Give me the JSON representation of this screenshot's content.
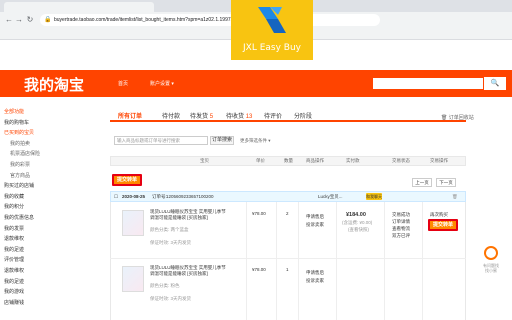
{
  "browser": {
    "url": "buyertrade.taobao.com/trade/itemlist/list_bought_items.htm?spm=a1z02.1.1997525045.2.wLuLBM"
  },
  "overlay": {
    "app_name": "JXL Easy Buy",
    "accent": "#f8c411"
  },
  "taobao": {
    "brand": "我的淘宝",
    "nav": [
      "首页",
      "账户设置 ▾"
    ],
    "search_button": "🔍",
    "brand_color": "#ff4400"
  },
  "sidebar": {
    "items": [
      {
        "label": "全部功能",
        "style": "red"
      },
      {
        "label": "我的购物车",
        "style": "normal"
      },
      {
        "label": "已买到的宝贝",
        "style": "red"
      },
      {
        "label": "我的拍卖",
        "style": "sub"
      },
      {
        "label": "机票酒店保险",
        "style": "sub"
      },
      {
        "label": "我的彩票",
        "style": "sub"
      },
      {
        "label": "官方商品",
        "style": "sub"
      },
      {
        "label": "购买过的店铺",
        "style": "normal"
      },
      {
        "label": "我的收藏",
        "style": "normal"
      },
      {
        "label": "我的积分",
        "style": "normal"
      },
      {
        "label": "我的优惠信息",
        "style": "normal"
      },
      {
        "label": "我的发票",
        "style": "normal"
      },
      {
        "label": "退款维权",
        "style": "normal"
      },
      {
        "label": "我的足迹",
        "style": "normal"
      },
      {
        "label": "评价管理",
        "style": "normal"
      },
      {
        "label": "退款维权",
        "style": "normal"
      },
      {
        "label": "我的足迹",
        "style": "normal"
      },
      {
        "label": "我的游戏",
        "style": "normal"
      },
      {
        "label": "店铺赚钱",
        "style": "normal"
      }
    ]
  },
  "tabs": [
    {
      "label": "所有订单",
      "count": ""
    },
    {
      "label": "待付款",
      "count": ""
    },
    {
      "label": "待发货",
      "count": "5"
    },
    {
      "label": "待收货",
      "count": "13"
    },
    {
      "label": "待评价",
      "count": ""
    },
    {
      "label": "分阶段",
      "count": ""
    }
  ],
  "recycle_bin": "🗑 订单回收站",
  "search": {
    "placeholder": "输入商品标题或订单号进行搜索",
    "button": "订单搜索",
    "more": "更多筛选条件 ▾"
  },
  "columns": [
    "宝贝",
    "单价",
    "数量",
    "商品操作",
    "实付款",
    "交易状态",
    "交易操作"
  ],
  "jxl_button": "提交转单",
  "pager": {
    "prev": "上一页",
    "next": "下一页"
  },
  "order": {
    "date": "2020-08-25",
    "order_no_label": "订单号:",
    "order_no": "1205609233657100200",
    "shop": "Lucky宝贝...",
    "tag": "和我聊天",
    "items": [
      {
        "title": "现货LULU睡眠仪苏宝宝 实用婴儿季节调温可能是能睡袋 [买房独家]",
        "spec": "颜色分类: 两个蓝盒",
        "guarantee": "保证时效: 3天内发货",
        "price": "¥78.00",
        "qty": "2",
        "action1": "申请售后",
        "action2": "投诉卖家"
      },
      {
        "title": "现货LULU睡眠仪苏宝宝 实用婴儿季节调温可能是能睡袋 [买房独家]",
        "spec": "颜色分类: 粉色",
        "guarantee": "保证时效: 3天内发货",
        "price": "¥78.00",
        "qty": "1",
        "action1": "申请售后",
        "action2": "投诉卖家"
      }
    ],
    "total": "¥184.00",
    "total_note": "(含运费: ¥0.00)",
    "total_note2": "(查看快照)",
    "status": [
      "交易成功",
      "订单详情",
      "查看物流",
      "双方已评"
    ],
    "op_label": "再次购买"
  },
  "helper": {
    "text": "有问题找\n找小蜜"
  }
}
